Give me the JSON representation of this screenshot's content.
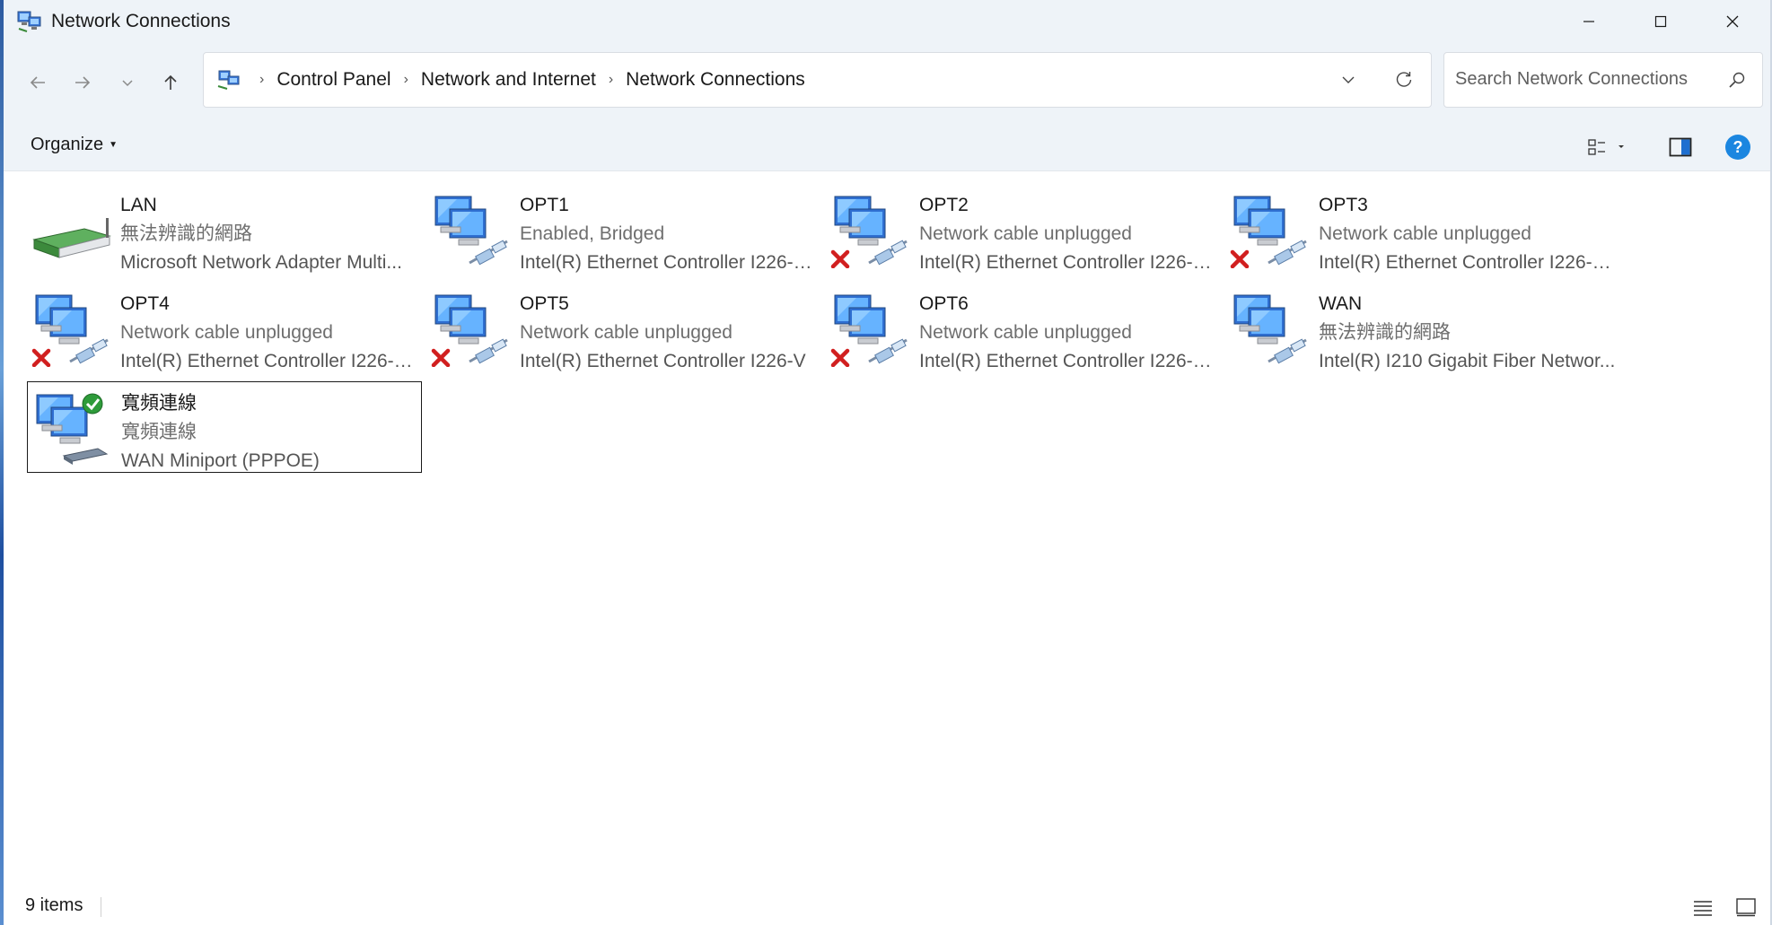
{
  "window": {
    "title": "Network Connections",
    "icons": {
      "app": "network-connections-icon",
      "minimize": "minimize-icon",
      "maximize": "maximize-icon",
      "close": "close-icon"
    }
  },
  "nav": {
    "back": "back-arrow-icon",
    "forward": "forward-arrow-icon",
    "recent": "chevron-down-icon",
    "up": "up-arrow-icon",
    "breadcrumbs": [
      "Control Panel",
      "Network and Internet",
      "Network Connections"
    ],
    "search_placeholder": "Search Network Connections"
  },
  "command_bar": {
    "organize_label": "Organize"
  },
  "connections": [
    {
      "name": "LAN",
      "status": "無法辨識的網路",
      "device": "Microsoft Network Adapter Multi...",
      "icon": "router-adapter-icon",
      "state": "connected"
    },
    {
      "name": "OPT1",
      "status": "Enabled, Bridged",
      "device": "Intel(R) Ethernet Controller I226-V...",
      "icon": "ethernet-adapter-icon",
      "state": "enabled"
    },
    {
      "name": "OPT2",
      "status": "Network cable unplugged",
      "device": "Intel(R) Ethernet Controller I226-V...",
      "icon": "ethernet-adapter-icon",
      "state": "unplugged"
    },
    {
      "name": "OPT3",
      "status": "Network cable unplugged",
      "device": "Intel(R) Ethernet Controller I226-V...",
      "icon": "ethernet-adapter-icon",
      "state": "unplugged"
    },
    {
      "name": "OPT4",
      "status": "Network cable unplugged",
      "device": "Intel(R) Ethernet Controller I226-V...",
      "icon": "ethernet-adapter-icon",
      "state": "unplugged"
    },
    {
      "name": "OPT5",
      "status": "Network cable unplugged",
      "device": "Intel(R) Ethernet Controller I226-V",
      "icon": "ethernet-adapter-icon",
      "state": "unplugged"
    },
    {
      "name": "OPT6",
      "status": "Network cable unplugged",
      "device": "Intel(R) Ethernet Controller I226-V...",
      "icon": "ethernet-adapter-icon",
      "state": "unplugged"
    },
    {
      "name": "WAN",
      "status": "無法辨識的網路",
      "device": "Intel(R) I210 Gigabit Fiber Networ...",
      "icon": "ethernet-adapter-icon",
      "state": "enabled"
    },
    {
      "name": "寬頻連線",
      "status": "寬頻連線",
      "device": "WAN Miniport (PPPOE)",
      "icon": "broadband-connection-icon",
      "state": "connected-check",
      "selected": true
    }
  ],
  "status_bar": {
    "item_count": "9 items"
  },
  "colors": {
    "chrome_bg": "#eef3f8",
    "accent": "#0067c0",
    "error_red": "#d11f1f",
    "check_green": "#2e9b3a"
  }
}
